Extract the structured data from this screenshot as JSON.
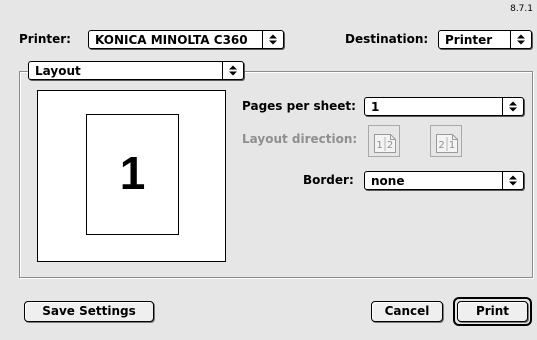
{
  "version": "8.7.1",
  "printer": {
    "label": "Printer:",
    "value": "KONICA MINOLTA C360"
  },
  "destination": {
    "label": "Destination:",
    "value": "Printer"
  },
  "panel": {
    "value": "Layout"
  },
  "preview": {
    "page_number": "1"
  },
  "pages_per_sheet": {
    "label": "Pages per sheet:",
    "value": "1"
  },
  "layout_direction": {
    "label": "Layout direction:",
    "option_ltr": [
      "1",
      "2"
    ],
    "option_rtl": [
      "2",
      "1"
    ]
  },
  "border": {
    "label": "Border:",
    "value": "none"
  },
  "buttons": {
    "save_settings": "Save Settings",
    "cancel": "Cancel",
    "print": "Print"
  },
  "icons": {
    "popup_arrows": "updown-arrows-icon",
    "page_fold": "page-dogear-icon"
  }
}
